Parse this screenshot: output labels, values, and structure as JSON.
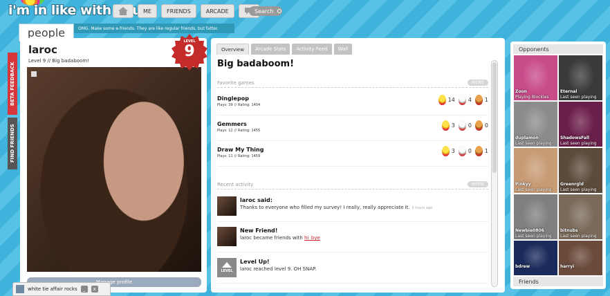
{
  "app": {
    "logo_text": "i'm in like with you.",
    "section": "people",
    "tagline": "OMG. Make some e-friends. They are like regular friends, but fatter."
  },
  "nav": {
    "home_icon": "home-icon",
    "me": "ME",
    "friends": "FRIENDS",
    "arcade": "ARCADE",
    "chat_icon": "speech-bubble-icon",
    "search": "Search"
  },
  "side_tabs": {
    "beta": "BETA FEEDBACK",
    "find": "FIND FRIENDS"
  },
  "profile": {
    "name": "laroc",
    "level_line": "Level 9 // Big badaboom!",
    "badge_label": "LEVEL",
    "badge_number": "9",
    "manage": "Manage profile"
  },
  "middle": {
    "tabs": [
      {
        "label": "Overview",
        "active": true
      },
      {
        "label": "Arcade Stats",
        "active": false
      },
      {
        "label": "Activity Feed",
        "active": false
      },
      {
        "label": "Wall",
        "active": false
      }
    ],
    "headline": "Big badaboom!",
    "favorite_title": "Favorite games",
    "more": "MORE",
    "games": [
      {
        "name": "Dinglepop",
        "plays": "Plays: 39",
        "rating": "Rating: 1404",
        "gold": "14",
        "silver": "4",
        "bronze": "1"
      },
      {
        "name": "Gemmers",
        "plays": "Plays: 12",
        "rating": "Rating: 1455",
        "gold": "3",
        "silver": "0",
        "bronze": "0"
      },
      {
        "name": "Draw My Thing",
        "plays": "Plays: 11",
        "rating": "Rating: 1459",
        "gold": "3",
        "silver": "0",
        "bronze": "1"
      }
    ],
    "activity_title": "Recent activity",
    "activities": [
      {
        "title": "laroc said:",
        "text": "Thanks to everyone who filled my survey! I really, really appreciate it.",
        "time": "5 hours ago"
      },
      {
        "title": "New Friend!",
        "text": "laroc became friends with",
        "link": "hi_bye"
      },
      {
        "title": "Level Up!",
        "text": "laroc reached level 9.  OH SNAP.",
        "icon_label": "LEVEL"
      }
    ]
  },
  "opponents": {
    "title": "Opponents",
    "footer": "Friends",
    "list": [
      {
        "name": "Zoon",
        "status": "Playing Blockles",
        "color": "#c84b8a"
      },
      {
        "name": "Eternal",
        "status": "Last seen playing",
        "color": "#3a3a3a"
      },
      {
        "name": "duplamon",
        "status": "Last seen playing",
        "color": "#8b8b8b"
      },
      {
        "name": "ShadowsFall",
        "status": "Last seen playing",
        "color": "#6a1e4a"
      },
      {
        "name": "Pinkyy",
        "status": "Last seen playing",
        "color": "#c79b74"
      },
      {
        "name": "Greenrgld",
        "status": "Last seen playing",
        "color": "#5c4a3a"
      },
      {
        "name": "Newbie0806",
        "status": "Last seen playing",
        "color": "#7f7f7f"
      },
      {
        "name": "bitnubs",
        "status": "Last seen playing",
        "color": "#7a6a5a"
      },
      {
        "name": "bdrew",
        "status": "",
        "color": "#1a2a5a"
      },
      {
        "name": "harryi",
        "status": "",
        "color": "#6a4a3a"
      }
    ]
  },
  "chat": {
    "label": "white tie affair rocks",
    "minimize": "_",
    "close": "x"
  }
}
